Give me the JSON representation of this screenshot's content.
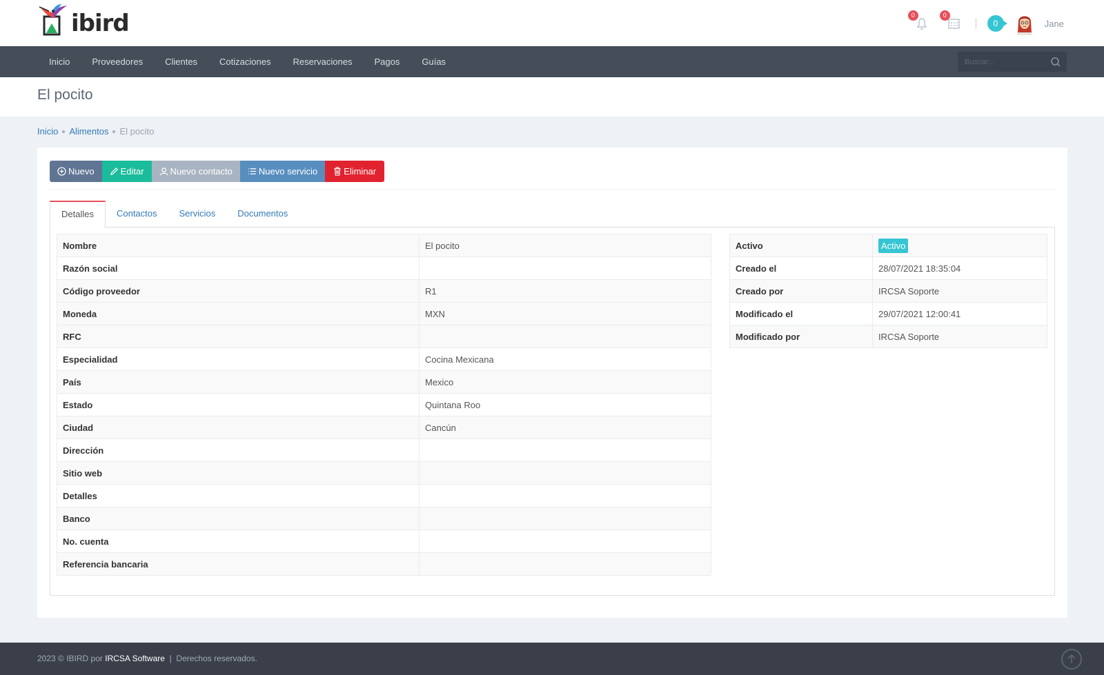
{
  "header": {
    "logo_text": "ibird",
    "notifications": {
      "count": "0"
    },
    "tasks": {
      "count": "0"
    },
    "cart": {
      "count": "0"
    },
    "user_name": "Jane"
  },
  "nav": {
    "items": [
      "Inicio",
      "Proveedores",
      "Clientes",
      "Cotizaciones",
      "Reservaciones",
      "Pagos",
      "Guías"
    ],
    "search_placeholder": "Buscar..."
  },
  "page": {
    "title": "El pocito"
  },
  "breadcrumb": [
    "Inicio",
    "Alimentos",
    "El pocito"
  ],
  "toolbar": {
    "nuevo": "Nuevo",
    "editar": "Editar",
    "nuevo_contacto": "Nuevo contacto",
    "nuevo_servicio": "Nuevo servicio",
    "eliminar": "Eliminar"
  },
  "tabs": [
    "Detalles",
    "Contactos",
    "Servicios",
    "Documentos"
  ],
  "details": [
    {
      "label": "Nombre",
      "value": "El pocito"
    },
    {
      "label": "Razón social",
      "value": ""
    },
    {
      "label": "Código proveedor",
      "value": "R1"
    },
    {
      "label": "Moneda",
      "value": "MXN"
    },
    {
      "label": "RFC",
      "value": ""
    },
    {
      "label": "Especialidad",
      "value": "Cocina Mexicana"
    },
    {
      "label": "País",
      "value": "Mexico"
    },
    {
      "label": "Estado",
      "value": "Quintana Roo"
    },
    {
      "label": "Ciudad",
      "value": "Cancún"
    },
    {
      "label": "Dirección",
      "value": ""
    },
    {
      "label": "Sitio web",
      "value": ""
    },
    {
      "label": "Detalles",
      "value": ""
    },
    {
      "label": "Banco",
      "value": ""
    },
    {
      "label": "No. cuenta",
      "value": ""
    },
    {
      "label": "Referencia bancaria",
      "value": ""
    }
  ],
  "meta": [
    {
      "label": "Activo",
      "value": "Activo"
    },
    {
      "label": "Creado el",
      "value": "28/07/2021 18:35:04"
    },
    {
      "label": "Creado por",
      "value": "IRCSA Soporte"
    },
    {
      "label": "Modificado el",
      "value": "29/07/2021 12:00:41"
    },
    {
      "label": "Modificado por",
      "value": "IRCSA Soporte"
    }
  ],
  "footer": {
    "prefix": "2023 © IBIRD por",
    "company": "IRCSA Software",
    "separator": "|",
    "rights": "Derechos reservados."
  },
  "colors": {
    "nav_bg": "#444d58",
    "accent_cyan": "#36c6d3",
    "btn_nuevo": "#5f7593",
    "btn_editar": "#1bbc9b",
    "btn_contacto": "#a9b4c2",
    "btn_servicio": "#578ebe",
    "btn_eliminar": "#e12330",
    "badge_red": "#e7505a"
  },
  "icons": {
    "notifications": "bell-icon",
    "tasks": "calendar-icon",
    "search": "search-icon",
    "nuevo": "plus-circle-icon",
    "editar": "pencil-icon",
    "nuevo_contacto": "user-icon",
    "nuevo_servicio": "list-icon",
    "eliminar": "trash-icon",
    "go_top": "arrow-up-circle-icon"
  }
}
